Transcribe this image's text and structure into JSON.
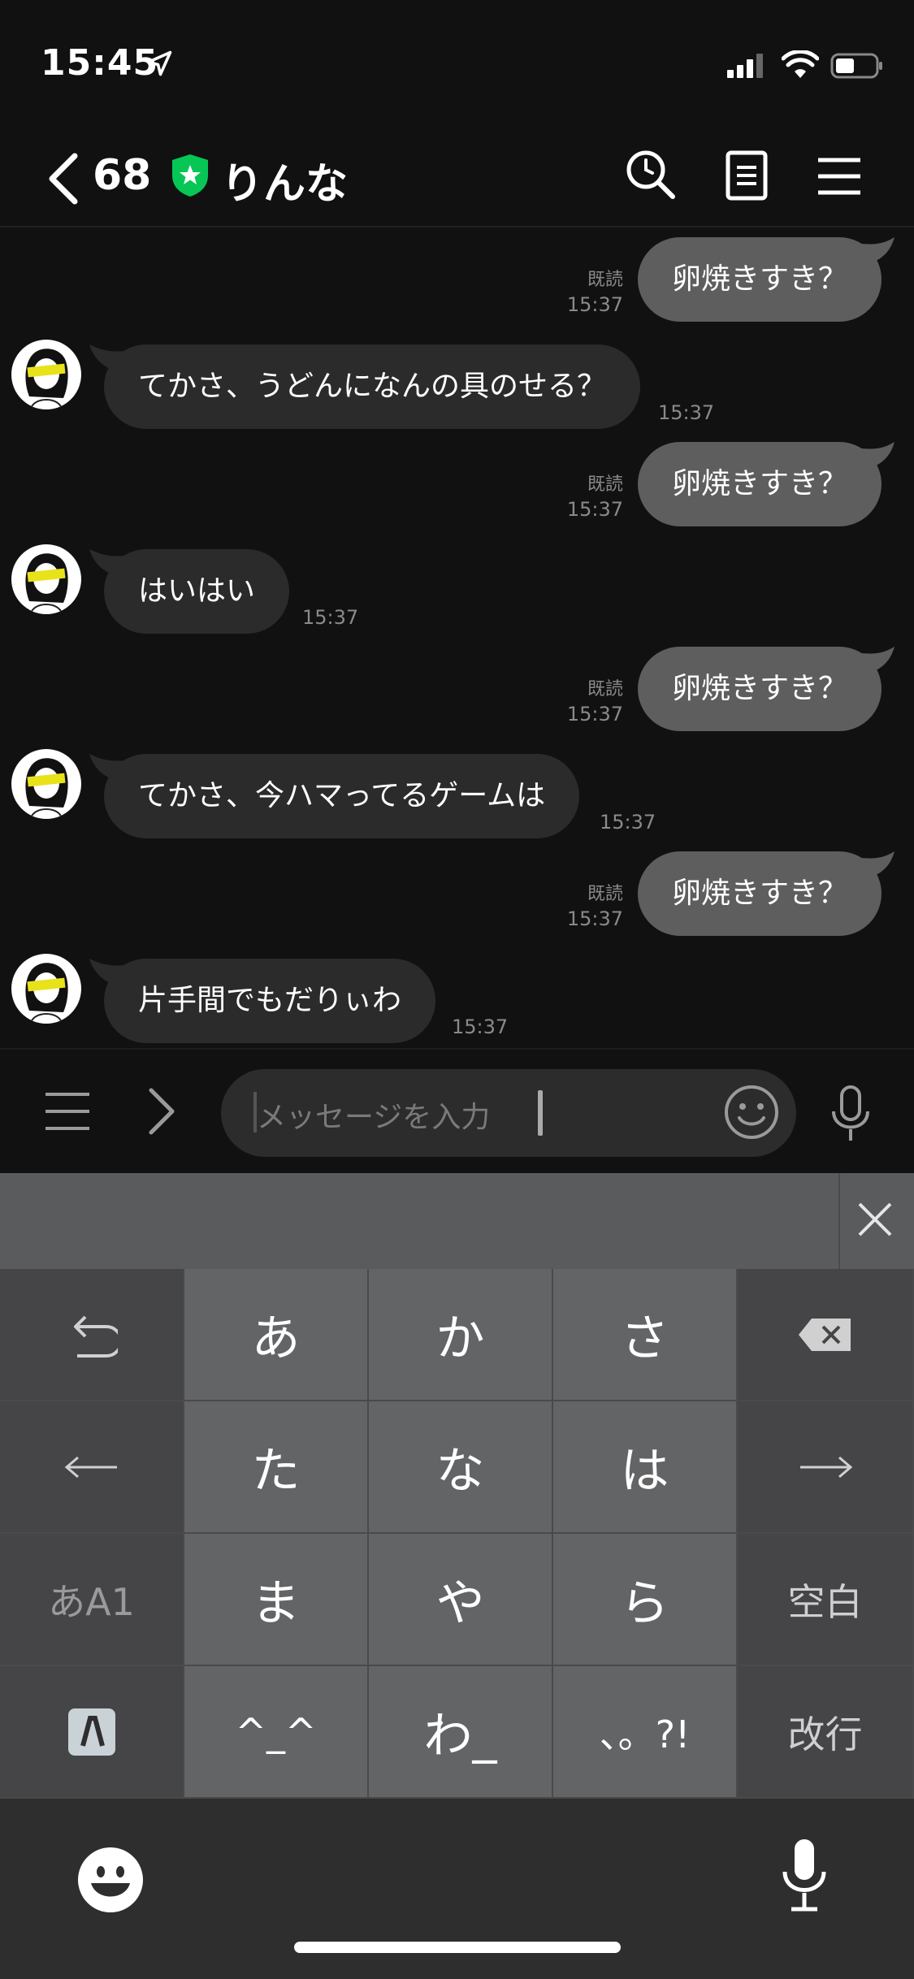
{
  "status_bar": {
    "time": "15:45"
  },
  "header": {
    "back_count": "68",
    "title": "りんな"
  },
  "messages": [
    {
      "dir": "out",
      "text": "卵焼きすき？",
      "read": "既読",
      "time": "15:37"
    },
    {
      "dir": "in",
      "text": "てかさ、うどんになんの具のせる？",
      "time": "15:37"
    },
    {
      "dir": "out",
      "text": "卵焼きすき？",
      "read": "既読",
      "time": "15:37"
    },
    {
      "dir": "in",
      "text": "はいはい",
      "time": "15:37"
    },
    {
      "dir": "out",
      "text": "卵焼きすき？",
      "read": "既読",
      "time": "15:37"
    },
    {
      "dir": "in",
      "text": "てかさ、今ハマってるゲームは",
      "time": "15:37"
    },
    {
      "dir": "out",
      "text": "卵焼きすき？",
      "read": "既読",
      "time": "15:37"
    },
    {
      "dir": "in",
      "text": "片手間でもだりぃわ",
      "time": "15:37"
    }
  ],
  "input": {
    "placeholder": "メッセージを入力"
  },
  "keyboard": {
    "keys": {
      "a": "あ",
      "ka": "か",
      "sa": "さ",
      "ta": "た",
      "na": "な",
      "ha": "は",
      "ma": "ま",
      "ya": "や",
      "ra": "ら",
      "face": "^_^",
      "wa": "わ_",
      "punct": "、。?!",
      "mode": "あA1",
      "space": "空白",
      "return": "改行"
    }
  },
  "colors": {
    "bg": "#111111",
    "bubble_out": "#5e5e5e",
    "bubble_in": "#2b2b2b",
    "accent_green": "#06c755"
  }
}
